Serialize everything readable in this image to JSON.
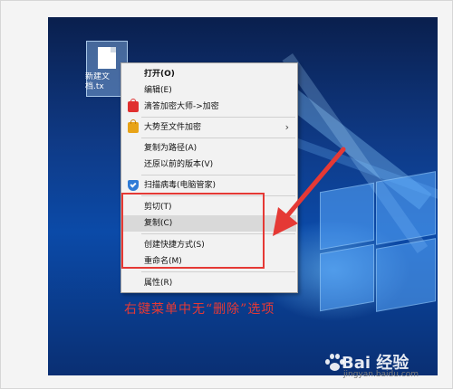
{
  "desktop": {
    "file_label_line1": "新建文",
    "file_label_line2": "档.tx"
  },
  "context_menu": {
    "items": [
      {
        "label": "打开(O)",
        "icon": "none",
        "bold": true
      },
      {
        "label": "编辑(E)",
        "icon": "none"
      },
      {
        "label": "滴答加密大师->加密",
        "icon": "red-lock-icon"
      },
      {
        "label": "大势至文件加密",
        "icon": "gold-lock-icon",
        "submenu": true
      },
      {
        "label": "复制为路径(A)",
        "icon": "none"
      },
      {
        "label": "还原以前的版本(V)",
        "icon": "none"
      },
      {
        "label": "扫描病毒(电脑管家)",
        "icon": "shield-icon"
      },
      {
        "label": "剪切(T)",
        "icon": "none"
      },
      {
        "label": "复制(C)",
        "icon": "none",
        "highlighted": true
      },
      {
        "label": "创建快捷方式(S)",
        "icon": "none"
      },
      {
        "label": "重命名(M)",
        "icon": "none"
      },
      {
        "label": "属性(R)",
        "icon": "none"
      }
    ],
    "submenu_glyph": "›"
  },
  "annotation": {
    "caption": "右键菜单中无“删除”选项",
    "highlight_color": "#e53935"
  },
  "watermark": {
    "brand": "Bai  经验",
    "url": "jingyan.baidu.com"
  }
}
